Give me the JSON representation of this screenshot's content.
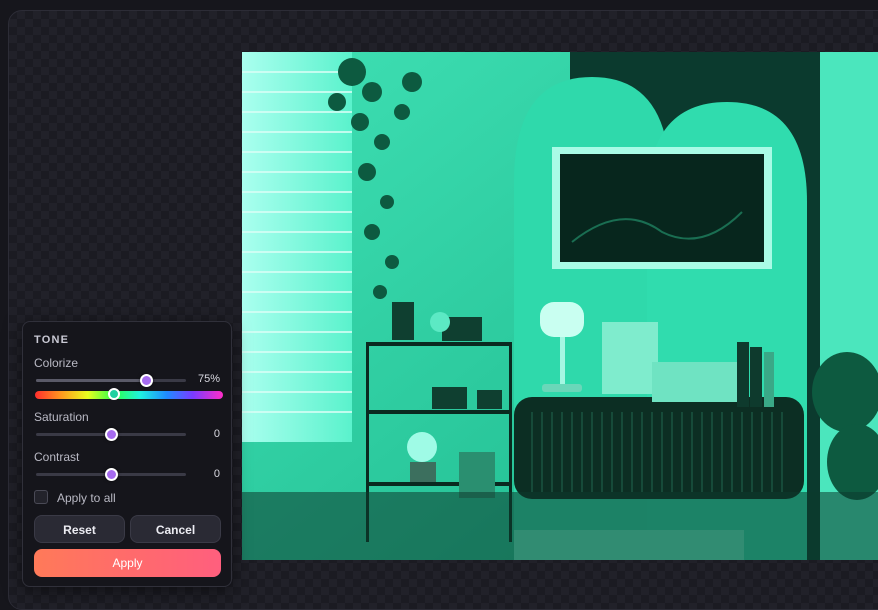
{
  "panel": {
    "title": "TONE",
    "colorize": {
      "label": "Colorize",
      "value_text": "75%",
      "level": 0.73
    },
    "hue": {
      "level": 0.42
    },
    "saturation": {
      "label": "Saturation",
      "value_text": "0",
      "level": 0.5
    },
    "contrast": {
      "label": "Contrast",
      "value_text": "0",
      "level": 0.5
    },
    "apply_to_all": {
      "label": "Apply to all",
      "checked": false
    },
    "buttons": {
      "reset": "Reset",
      "cancel": "Cancel",
      "apply": "Apply"
    }
  },
  "colors": {
    "tint": "#1fd0a0",
    "thumb": "#a66bf0",
    "apply_gradient_start": "#ff7a59",
    "apply_gradient_end": "#ff5f7e"
  }
}
